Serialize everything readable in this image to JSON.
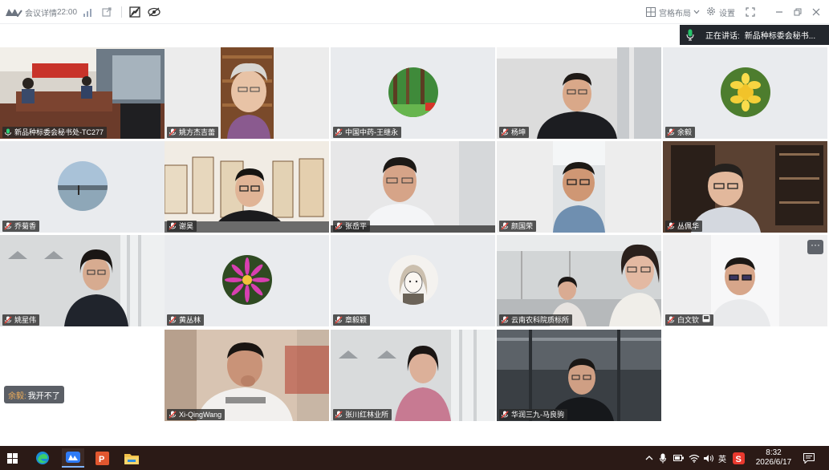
{
  "titlebar": {
    "app_name": "会议详情",
    "time": "22:00",
    "layout_label": "宫格布局",
    "settings_label": "设置"
  },
  "speaking": {
    "prefix": "正在讲话:",
    "name": "新品种标委会秘书..."
  },
  "tiles": [
    {
      "name": "新品种标委会秘书处-TC277",
      "kind": "room",
      "active_speaker": true
    },
    {
      "name": "姚方杰吉蕾",
      "kind": "woman-bookshelf"
    },
    {
      "name": "中国中药-王继永",
      "kind": "avatar-forest"
    },
    {
      "name": "杨坤",
      "kind": "man-office"
    },
    {
      "name": "余毅",
      "kind": "avatar-yellow-flower"
    },
    {
      "name": "乔菊香",
      "kind": "avatar-lake"
    },
    {
      "name": "谢昊",
      "kind": "man-exhibit"
    },
    {
      "name": "张岳平",
      "kind": "man-white"
    },
    {
      "name": "颜国荣",
      "kind": "man-phone"
    },
    {
      "name": "丛佩华",
      "kind": "man-bookcase"
    },
    {
      "name": "姚星伟",
      "kind": "woman-room"
    },
    {
      "name": "黄丛林",
      "kind": "avatar-pink-flower"
    },
    {
      "name": "章毅颖",
      "kind": "avatar-sketch"
    },
    {
      "name": "云南农科院质标所",
      "kind": "two-women"
    },
    {
      "name": "白文钦",
      "kind": "man-portrait",
      "screen_icon": true
    },
    {
      "name": "Xi-QingWang",
      "kind": "man-blur"
    },
    {
      "name": "张川红林业所",
      "kind": "woman-office"
    },
    {
      "name": "华润三九-马良驹",
      "kind": "man-dark"
    }
  ],
  "chat": {
    "sender": "余毅:",
    "message": "我开不了"
  },
  "more_button": "···",
  "taskbar": {
    "ime": "英",
    "clock_time": "8:32",
    "clock_date": "2026/6/17"
  },
  "colors": {
    "active_speaker_border": "#2fbf6a",
    "taskbar_bg": "#2b1a16",
    "speaking_bg": "#23272d",
    "chat_sender": "#f3b05a"
  }
}
